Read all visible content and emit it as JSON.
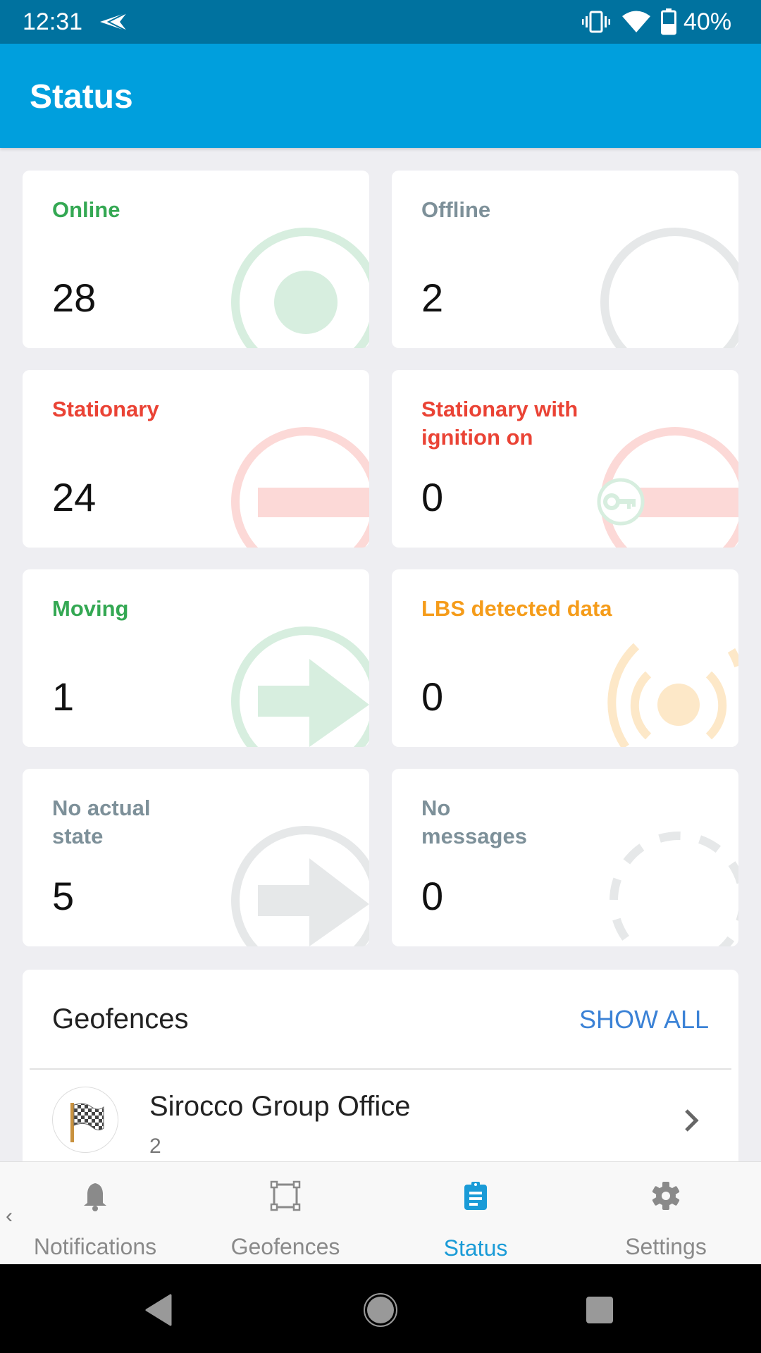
{
  "status_bar": {
    "time": "12:31",
    "battery": "40%",
    "icons": [
      "send-icon",
      "vibrate-icon",
      "wifi-icon",
      "battery-icon"
    ]
  },
  "app_bar": {
    "title": "Status"
  },
  "colors": {
    "accent": "#009fdd",
    "status_bar": "#00729f",
    "green": "#34a853",
    "red": "#ea4335",
    "orange": "#f59c1a",
    "grey": "#7d9099",
    "link": "#3b82d6"
  },
  "status_cards": [
    {
      "label": "Online",
      "value": "28",
      "color": "#34a853",
      "icon": "online-icon"
    },
    {
      "label": "Offline",
      "value": "2",
      "color": "#7d9099",
      "icon": "offline-icon"
    },
    {
      "label": "Stationary",
      "value": "24",
      "color": "#ea4335",
      "icon": "stationary-icon"
    },
    {
      "label": "Stationary with ignition on",
      "value": "0",
      "color": "#ea4335",
      "icon": "ignition-key-icon"
    },
    {
      "label": "Moving",
      "value": "1",
      "color": "#34a853",
      "icon": "moving-arrow-icon"
    },
    {
      "label": "LBS detected data",
      "value": "0",
      "color": "#f59c1a",
      "icon": "lbs-signal-icon"
    },
    {
      "label": "No actual state",
      "value": "5",
      "color": "#7d9099",
      "icon": "no-state-arrow-icon"
    },
    {
      "label": "No messages",
      "value": "0",
      "color": "#7d9099",
      "icon": "dashed-circle-icon"
    }
  ],
  "geofences": {
    "title": "Geofences",
    "show_all": "SHOW ALL",
    "items": [
      {
        "name": "Sirocco Group Office",
        "count": "2",
        "icon": "checkered-flag-icon"
      }
    ]
  },
  "bottom_nav": {
    "items": [
      {
        "label": "Notifications",
        "icon": "bell-icon",
        "active": false
      },
      {
        "label": "Geofences",
        "icon": "geofence-square-icon",
        "active": false
      },
      {
        "label": "Status",
        "icon": "clipboard-icon",
        "active": true
      },
      {
        "label": "Settings",
        "icon": "gear-icon",
        "active": false
      }
    ]
  }
}
